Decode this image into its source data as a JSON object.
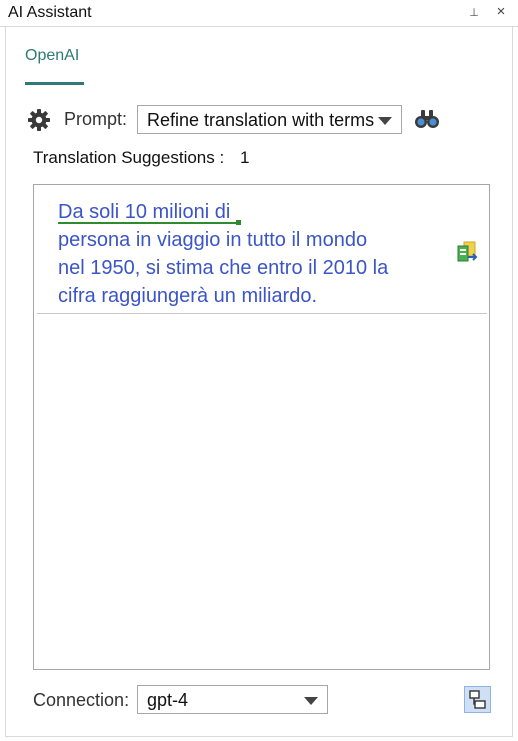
{
  "window": {
    "title": "AI Assistant",
    "pin_glyph": "⊥",
    "close_glyph": "×"
  },
  "tabs": [
    {
      "label": "OpenAI",
      "active": true
    }
  ],
  "prompt": {
    "label": "Prompt:",
    "selected": "Refine translation with terms",
    "icons": [
      "gear-icon",
      "binoculars-icon"
    ]
  },
  "suggestions": {
    "label": "Translation Suggestions :",
    "count": "1",
    "items": [
      {
        "lines": [
          "Da soli 10 milioni di",
          "persona in viaggio in tutto il mondo",
          "nel 1950, si stima che entro il 2010 la",
          "cifra raggiungerà un miliardo."
        ],
        "underlined_term": "Da soli 10 milioni di",
        "action_icon": "apply-suggestion-icon"
      }
    ]
  },
  "connection": {
    "label": "Connection:",
    "selected": "gpt-4",
    "layout_icon": "layout-toggle-icon"
  },
  "colors": {
    "accent": "#2e7a78",
    "suggestion_text": "#3b55c8",
    "term_underline": "#2e8b2e",
    "layout_button_bg": "#cfe0f5"
  }
}
